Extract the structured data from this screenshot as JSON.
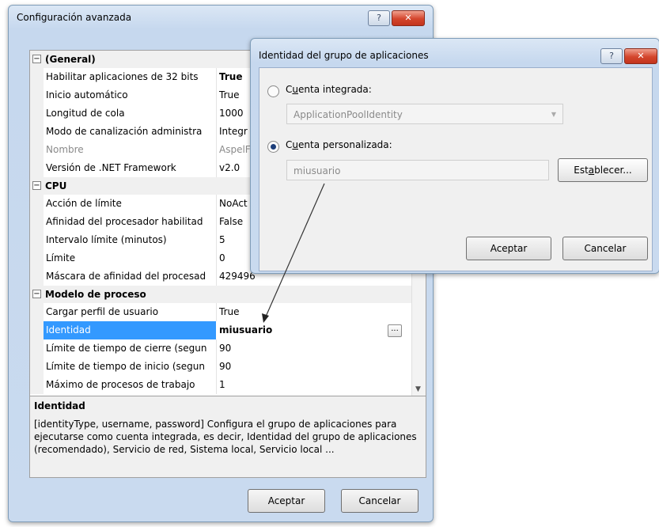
{
  "main_dialog": {
    "title": "Configuración avanzada",
    "help_btn": "?",
    "close_btn": "✕",
    "categories": [
      {
        "label": "(General)",
        "rows": [
          {
            "name": "Habilitar aplicaciones de 32 bits",
            "value": "True"
          },
          {
            "name": "Inicio automático",
            "value": "True"
          },
          {
            "name": "Longitud de cola",
            "value": "1000"
          },
          {
            "name": "Modo de canalización administra",
            "value": "Integr"
          },
          {
            "name": "Nombre",
            "value": "AspelF"
          },
          {
            "name": "Versión de .NET Framework",
            "value": "v2.0"
          }
        ]
      },
      {
        "label": "CPU",
        "rows": [
          {
            "name": "Acción de límite",
            "value": "NoAct"
          },
          {
            "name": "Afinidad del procesador habilitad",
            "value": "False"
          },
          {
            "name": "Intervalo límite (minutos)",
            "value": "5"
          },
          {
            "name": "Límite",
            "value": "0"
          },
          {
            "name": "Máscara de afinidad del procesad",
            "value": "429496"
          }
        ]
      },
      {
        "label": "Modelo de proceso",
        "rows": [
          {
            "name": "Cargar perfil de usuario",
            "value": "True"
          },
          {
            "name": "Identidad",
            "value": "miusuario"
          },
          {
            "name": "Límite de tiempo de cierre (segun",
            "value": "90"
          },
          {
            "name": "Límite de tiempo de inicio (segun",
            "value": "90"
          },
          {
            "name": "Máximo de procesos de trabajo",
            "value": "1"
          }
        ]
      }
    ],
    "ellipsis_btn": "...",
    "description": {
      "title": "Identidad",
      "text": "[identityType, username, password] Configura el grupo de aplicaciones para ejecutarse como cuenta integrada, es decir, Identidad del grupo de aplicaciones (recomendado), Servicio de red, Sistema local, Servicio local ..."
    },
    "ok_label": "Aceptar",
    "cancel_label": "Cancelar"
  },
  "identity_dialog": {
    "title": "Identidad del grupo de aplicaciones",
    "help_btn": "?",
    "close_btn": "✕",
    "builtin_label_pre": "C",
    "builtin_label_ul": "u",
    "builtin_label_post": "enta integrada:",
    "builtin_value": "ApplicationPoolIdentity",
    "custom_label_pre": "C",
    "custom_label_ul": "u",
    "custom_label_post": "enta personalizada:",
    "custom_value": "miusuario",
    "set_label_pre": "Est",
    "set_label_ul": "a",
    "set_label_post": "blecer...",
    "ok_label": "Aceptar",
    "cancel_label": "Cancelar",
    "selected_option": "custom"
  }
}
